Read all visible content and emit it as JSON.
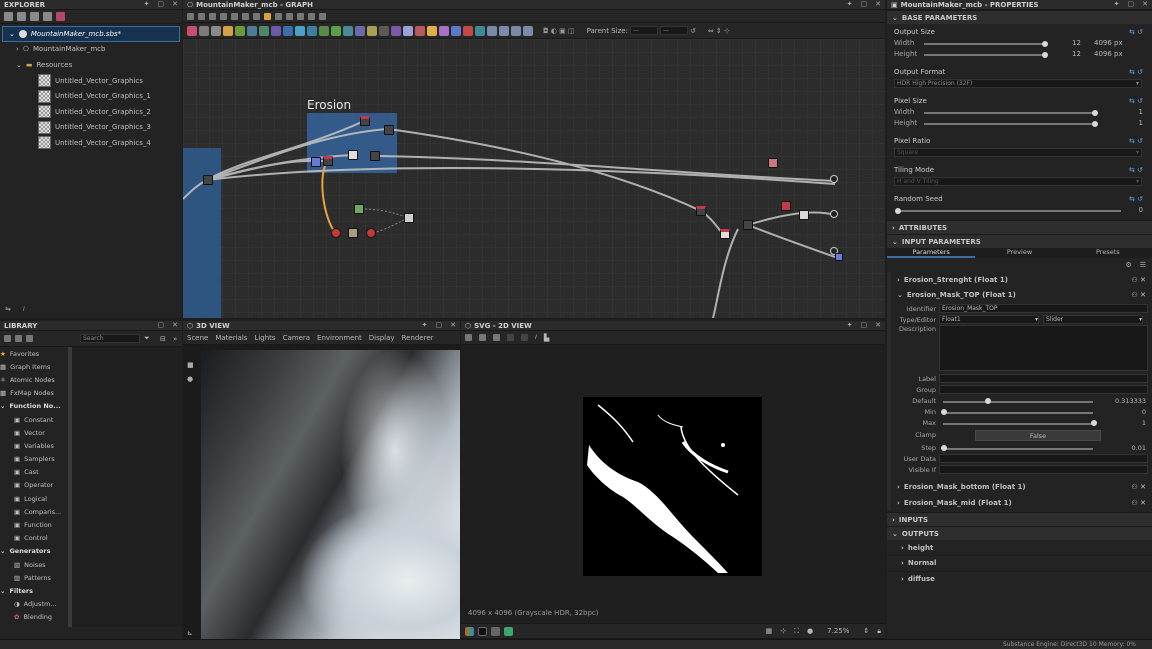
{
  "explorer": {
    "title": "EXPLORER",
    "package": "MountainMaker_mcb.sbs*",
    "graph": "MountainMaker_mcb",
    "resources": "Resources",
    "items": [
      "Untitled_Vector_Graphics",
      "Untitled_Vector_Graphics_1",
      "Untitled_Vector_Graphics_2",
      "Untitled_Vector_Graphics_3",
      "Untitled_Vector_Graphics_4"
    ]
  },
  "graph": {
    "title": "MountainMaker_mcb - GRAPH",
    "frame_label": "Erosion",
    "parent_size_label": "Parent Size:"
  },
  "library": {
    "title": "LIBRARY",
    "search_placeholder": "Search",
    "categories": [
      "Favorites",
      "Graph Items",
      "Atomic Nodes",
      "FxMap Nodes",
      "Function No..."
    ],
    "function_items": [
      "Constant",
      "Vector",
      "Variables",
      "Samplers",
      "Cast",
      "Operator",
      "Logical",
      "Comparis...",
      "Function",
      "Control"
    ],
    "generators": "Generators",
    "gen_items": [
      "Noises",
      "Patterns"
    ],
    "filters": "Filters",
    "filter_items": [
      "Adjustm...",
      "Blending"
    ]
  },
  "view3d": {
    "title": "3D VIEW",
    "menu": [
      "Scene",
      "Materials",
      "Lights",
      "Camera",
      "Environment",
      "Display",
      "Renderer"
    ]
  },
  "view2d": {
    "title": "SVG - 2D VIEW",
    "status": "4096 x 4096 (Grayscale HDR, 32bpc)",
    "zoom": "7.25%"
  },
  "props": {
    "title": "MountainMaker_mcb - PROPERTIES",
    "base": "BASE PARAMETERS",
    "output_size": "Output Size",
    "width": "Width",
    "height": "Height",
    "size_val": "12",
    "size_px": "4096 px",
    "output_format": "Output Format",
    "format_val": "HDR High Precision (32F)",
    "pixel_size": "Pixel Size",
    "pixel_ratio": "Pixel Ratio",
    "ratio_val": "Square",
    "tiling_mode": "Tiling Mode",
    "tiling_val": "H and V Tiling",
    "random_seed": "Random Seed",
    "seed_val": "0",
    "one": "1",
    "attributes": "ATTRIBUTES",
    "input_params": "INPUT PARAMETERS",
    "tabs": [
      "Parameters",
      "Preview",
      "Presets"
    ],
    "params": [
      {
        "name": "Erosion_Strenght (Float 1)"
      },
      {
        "name": "Erosion_Mask_TOP (Float 1)"
      }
    ],
    "identifier_label": "Identifier",
    "identifier_val": "Erosion_Mask_TOP",
    "type_label": "Type/Editor",
    "type_val": "Float1",
    "editor_val": "Slider",
    "desc_label": "Description",
    "label_label": "Label",
    "group_label": "Group",
    "default_label": "Default",
    "default_val": "0.313333",
    "min_label": "Min",
    "min_val": "0",
    "max_label": "Max",
    "max_val": "1",
    "clamp_label": "Clamp",
    "clamp_val": "False",
    "step_label": "Step",
    "step_val": "0.01",
    "userdata_label": "User Data",
    "visible_label": "Visible If",
    "params2": [
      "Erosion_Mask_bottom (Float 1)",
      "Erosion_Mask_mid (Float 1)"
    ],
    "inputs": "INPUTS",
    "outputs": "OUTPUTS",
    "output_items": [
      "height",
      "Normal",
      "diffuse"
    ]
  },
  "statusbar": {
    "text": "Substance Engine: Direct3D 10 Memory: 0%"
  },
  "colors": {
    "accent": "#3a6ea5",
    "frame": "#3b6aa0",
    "wire": "#c8c8c8",
    "orange": "#e8a33c"
  }
}
